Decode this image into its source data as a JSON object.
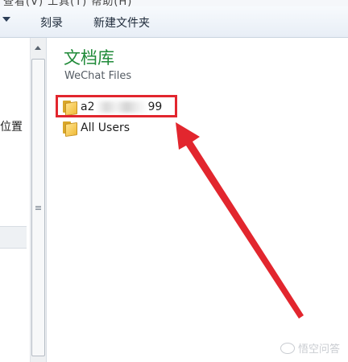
{
  "menu_cut": "查看(V)  工具(T)  帮助(H)",
  "toolbar": {
    "burn_label": "刻录",
    "new_folder_label": "新建文件夹"
  },
  "nav": {
    "location_label": "位置"
  },
  "library": {
    "title": "文档库",
    "subtitle": "WeChat Files"
  },
  "files": [
    {
      "name_prefix": "a2",
      "name_suffix": "99",
      "obscured": true
    },
    {
      "name": "All Users"
    }
  ],
  "annotation": {
    "color": "#e2262e"
  },
  "watermark": {
    "text": "悟空问答"
  },
  "colors": {
    "library_title": "#1f8a38",
    "folder": "#f0bb3a"
  }
}
